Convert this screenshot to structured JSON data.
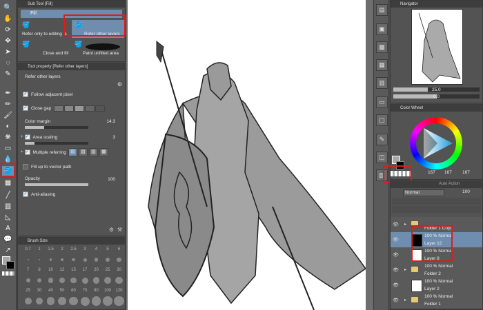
{
  "subtool": {
    "panel_title": "Sub Tool [Fill]",
    "tab_label": "Fill",
    "items": [
      {
        "label": "Refer only to editing la"
      },
      {
        "label": "Refer other layers"
      },
      {
        "label": "Close and fill"
      },
      {
        "label": "Paint unfilled area"
      }
    ]
  },
  "toolprop": {
    "panel_title": "Tool property [Refer other layers]",
    "header": "Refer other layers",
    "follow_adjacent": "Follow adjacent pixel",
    "close_gap": "Close gap",
    "color_margin_label": "Color margin",
    "color_margin_value": "14.3",
    "color_margin_fill": 0.3,
    "area_scaling_label": "Area scaling",
    "area_scaling_value": "3",
    "area_scaling_fill": 0.15,
    "multiple_referring": "Multiple referring",
    "fill_up_vector": "Fill up to vector path",
    "opacity_label": "Opacity",
    "opacity_value": "100",
    "opacity_fill": 1.0,
    "anti_aliasing": "Anti-aliasing"
  },
  "brushsize": {
    "panel_title": "Brush Size",
    "row1": [
      "0.7",
      "1",
      "1.5",
      "2",
      "2.5",
      "3",
      "4",
      "5",
      "6"
    ],
    "row2": [
      "7",
      "8",
      "10",
      "12",
      "15",
      "17",
      "20",
      "25",
      "30"
    ],
    "row3": [
      "25",
      "30",
      "40",
      "50",
      "60",
      "70",
      "80",
      "100",
      "120"
    ]
  },
  "navigator": {
    "panel_title": "Navigator",
    "zoom": "25.0",
    "angle": "0.0"
  },
  "colorwheel": {
    "panel_title": "Color Wheel",
    "hsv": [
      "167",
      "167",
      "167"
    ],
    "main_color": "#a7a7a7"
  },
  "layers": {
    "panel_title": "Layer",
    "tab2": "Auto Action",
    "blend_mode": "Normal",
    "opacity": "100",
    "rows": [
      {
        "mode": "",
        "name": "Folder 1 Copy",
        "type": "folder"
      },
      {
        "mode": "100 % Normal",
        "name": "Layer 12",
        "type": "layer",
        "selected": true
      },
      {
        "mode": "100 % Normal",
        "name": "Layer 8",
        "type": "layer"
      },
      {
        "mode": "100 % Normal",
        "name": "Folder 2",
        "type": "folder"
      },
      {
        "mode": "100 % Normal",
        "name": "Layer 2",
        "type": "layer"
      },
      {
        "mode": "100 % Normal",
        "name": "Folder 1",
        "type": "folder"
      }
    ]
  },
  "colors": {
    "accent": "#6f8eaf",
    "highlight": "#e01b1b",
    "panel": "#535353"
  }
}
